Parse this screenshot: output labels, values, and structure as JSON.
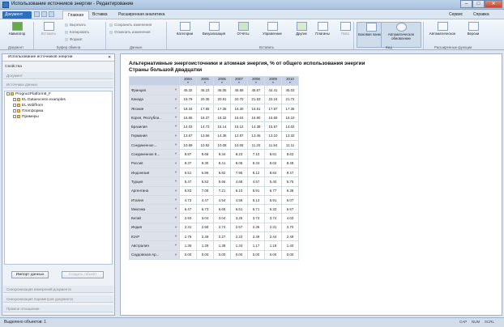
{
  "window": {
    "title": "Использование источников энергии - Редактирование"
  },
  "menubar": {
    "doc_button": "Документ",
    "tabs": [
      "Главная",
      "Вставка",
      "Расширенная аналитика"
    ],
    "right_items": [
      "Сервис",
      "Справка"
    ]
  },
  "ribbon": {
    "nav": {
      "label": "Навигатор"
    },
    "clipboard": {
      "paste": "Вставить",
      "cut": "Вырезать",
      "copy": "Копировать",
      "format": "Формат"
    },
    "data": {
      "save": "Сохранить изменения",
      "cancel": "Отменить изменения"
    },
    "buttons": [
      "Категории",
      "Визуализация",
      "Отчёты",
      "Управление",
      "Другие",
      "Плагины",
      "Пиво"
    ],
    "view": {
      "panel": "Боковая панель",
      "auto": "Автоматическое обновление",
      "button3": "Автоматическое",
      "versions": "Версии"
    },
    "groups": [
      "Документ",
      "Буфер обмена",
      "Данные",
      "Вставить",
      "Вид",
      "Расширенные функции"
    ]
  },
  "left_panel": {
    "tab_title": "Использование источников энергии",
    "header": "Свойства",
    "sections": [
      "Документ",
      "Источники данных"
    ],
    "tree": [
      {
        "label": "PrognozPlatform8_F",
        "level": 0
      },
      {
        "label": "EL Dataexcess examples",
        "level": 1
      },
      {
        "label": "EL Wdiffrom",
        "level": 1
      },
      {
        "label": "Платформа",
        "level": 1
      },
      {
        "label": "Примеры",
        "level": 1
      }
    ],
    "import_button": "Импорт данных",
    "create_button": "Создать объект",
    "bottom_sections": [
      "Синхронизация измерений документа",
      "Синхронизация параметров документа",
      "Прямое отношение"
    ]
  },
  "report": {
    "title": "Альтернативные энергоисточники и атомная энергия, % от общего использования энергии",
    "subtitle": "Страны большой двадцатки",
    "years": [
      "2004",
      "2005",
      "2006",
      "2007",
      "2008",
      "2009",
      "2010"
    ],
    "rows": [
      {
        "country": "Франция",
        "values": [
          "45.32",
          "45.23",
          "45.05",
          "45.58",
          "45.57",
          "44.41",
          "45.03"
        ]
      },
      {
        "country": "Канада",
        "values": [
          "19.79",
          "20.35",
          "20.91",
          "20.70",
          "21.53",
          "22.24",
          "21.72"
        ]
      },
      {
        "country": "Япония",
        "values": [
          "18.34",
          "17.85",
          "17.36",
          "16.30",
          "16.51",
          "17.87",
          "17.35"
        ]
      },
      {
        "country": "Корея, Республи...",
        "values": [
          "16.55",
          "18.37",
          "18.32",
          "16.04",
          "16.90",
          "16.59",
          "16.10"
        ]
      },
      {
        "country": "Бразилия",
        "values": [
          "14.03",
          "14.73",
          "15.14",
          "15.12",
          "14.39",
          "15.57",
          "14.02"
        ]
      },
      {
        "country": "Германия",
        "values": [
          "13.67",
          "13.66",
          "14.36",
          "12.87",
          "13.46",
          "13.10",
          "13.32"
        ]
      },
      {
        "country": "Соединенное...",
        "values": [
          "10.89",
          "10.82",
          "10.08",
          "10.06",
          "11.20",
          "11.84",
          "11.11"
        ]
      },
      {
        "country": "Соединенное К...",
        "values": [
          "8.87",
          "9.68",
          "9.34",
          "8.23",
          "7.10",
          "8.81",
          "8.63"
        ]
      },
      {
        "country": "Россия",
        "values": [
          "8.37",
          "8.30",
          "8.41",
          "8.06",
          "8.34",
          "8.02",
          "8.48"
        ]
      },
      {
        "country": "Индонезия",
        "values": [
          "6.51",
          "6.86",
          "6.82",
          "7.95",
          "8.12",
          "8.84",
          "8.47"
        ]
      },
      {
        "country": "Турция",
        "values": [
          "5.47",
          "5.53",
          "5.66",
          "4.68",
          "4.57",
          "5.40",
          "5.75"
        ]
      },
      {
        "country": "Аргентина",
        "values": [
          "6.83",
          "7.08",
          "7.21",
          "6.10",
          "5.91",
          "6.77",
          "6.38"
        ]
      },
      {
        "country": "Италия",
        "values": [
          "4.73",
          "4.47",
          "4.54",
          "4.58",
          "5.13",
          "5.91",
          "6.07"
        ]
      },
      {
        "country": "Мексика",
        "values": [
          "6.47",
          "6.73",
          "6.65",
          "6.61",
          "6.71",
          "6.32",
          "6.67"
        ]
      },
      {
        "country": "Китай",
        "values": [
          "2.93",
          "3.04",
          "3.04",
          "3.25",
          "3.74",
          "3.74",
          "4.03"
        ]
      },
      {
        "country": "Индия",
        "values": [
          "2.31",
          "2.68",
          "2.74",
          "2.67",
          "2.36",
          "2.31",
          "2.70"
        ]
      },
      {
        "country": "ЮАР",
        "values": [
          "2.79",
          "2.49",
          "2.27",
          "2.22",
          "2.49",
          "2.44",
          "2.49"
        ]
      },
      {
        "country": "Австралия",
        "values": [
          "1.36",
          "1.29",
          "1.38",
          "1.34",
          "1.17",
          "1.18",
          "1.40"
        ]
      },
      {
        "country": "Саудовская Ар...",
        "values": [
          "0.00",
          "0.00",
          "0.00",
          "0.00",
          "0.00",
          "0.00",
          "0.00"
        ]
      }
    ]
  },
  "status": {
    "left": "Выделено объектов: 1",
    "right": [
      "CAP",
      "NUM",
      "SCRL"
    ]
  }
}
